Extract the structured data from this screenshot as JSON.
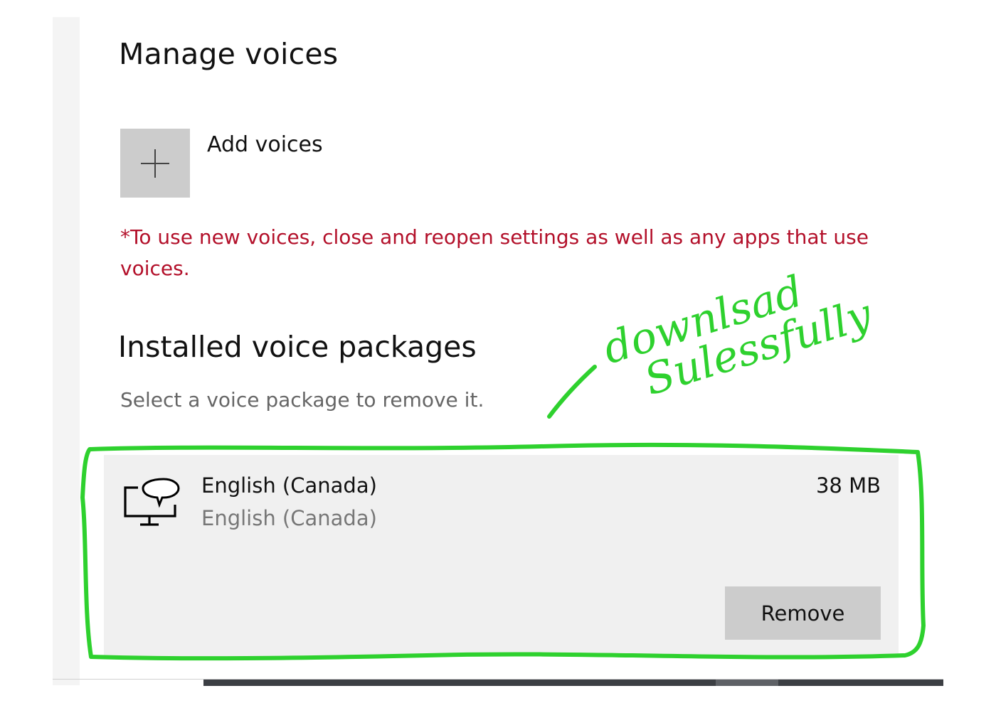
{
  "manage": {
    "heading": "Manage voices",
    "add_voices_label": "Add voices",
    "notice": "*To use new voices, close and reopen settings as well as any apps that use voices."
  },
  "installed": {
    "heading": "Installed voice packages",
    "instructions": "Select a voice package to remove it.",
    "packages": [
      {
        "name": "English (Canada)",
        "subtitle": "English (Canada)",
        "size": "38 MB",
        "icon": "speech-display-icon",
        "remove_label": "Remove"
      }
    ]
  },
  "annotation": {
    "handwritten_text": "download Sulessfully",
    "color": "#2ed12e"
  },
  "colors": {
    "notice": "#b3102a",
    "tile": "#cccccc",
    "package_bg": "#f0f0f0"
  }
}
